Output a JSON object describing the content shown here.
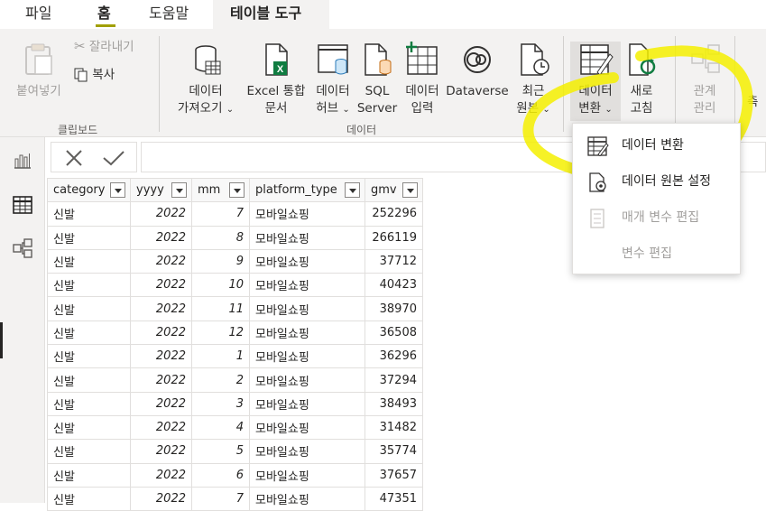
{
  "tabs": [
    {
      "label": "파일"
    },
    {
      "label": "홈"
    },
    {
      "label": "도움말"
    },
    {
      "label": "테이블 도구"
    }
  ],
  "ribbon": {
    "clipboard": {
      "paste": "붙여넣기",
      "cut": "잘라내기",
      "copy": "복사",
      "group": "클립보드"
    },
    "data": {
      "get_data": [
        "데이터",
        "가져오기"
      ],
      "excel": [
        "Excel 통합",
        "문서"
      ],
      "hub": [
        "데이터",
        "허브"
      ],
      "sql": [
        "SQL",
        "Server"
      ],
      "enter": [
        "데이터",
        "입력"
      ],
      "dataverse": "Dataverse",
      "recent": [
        "최근",
        "원본"
      ],
      "group": "데이터"
    },
    "transform": [
      "데이터",
      "변환"
    ],
    "refresh": [
      "새로",
      "고침"
    ],
    "relations": [
      "관계",
      "관리"
    ],
    "calc_partial": "측"
  },
  "menu": {
    "items": [
      {
        "label": "데이터 변환",
        "enabled": true,
        "icon": "transform-data-icon"
      },
      {
        "label": "데이터 원본 설정",
        "enabled": true,
        "icon": "data-source-settings-icon"
      },
      {
        "label": "매개 변수 편집",
        "enabled": false,
        "icon": "edit-parameters-icon"
      },
      {
        "label": "변수 편집",
        "enabled": false,
        "icon": ""
      }
    ]
  },
  "table": {
    "columns": [
      "category",
      "yyyy",
      "mm",
      "platform_type",
      "gmv"
    ],
    "rows": [
      [
        "신발",
        "2022",
        "7",
        "모바일쇼핑",
        "252296"
      ],
      [
        "신발",
        "2022",
        "8",
        "모바일쇼핑",
        "266119"
      ],
      [
        "신발",
        "2022",
        "9",
        "모바일쇼핑",
        "37712"
      ],
      [
        "신발",
        "2022",
        "10",
        "모바일쇼핑",
        "40423"
      ],
      [
        "신발",
        "2022",
        "11",
        "모바일쇼핑",
        "38970"
      ],
      [
        "신발",
        "2022",
        "12",
        "모바일쇼핑",
        "36508"
      ],
      [
        "신발",
        "2022",
        "1",
        "모바일쇼핑",
        "36296"
      ],
      [
        "신발",
        "2022",
        "2",
        "모바일쇼핑",
        "37294"
      ],
      [
        "신발",
        "2022",
        "3",
        "모바일쇼핑",
        "38493"
      ],
      [
        "신발",
        "2022",
        "4",
        "모바일쇼핑",
        "31482"
      ],
      [
        "신발",
        "2022",
        "5",
        "모바일쇼핑",
        "35774"
      ],
      [
        "신발",
        "2022",
        "6",
        "모바일쇼핑",
        "37657"
      ],
      [
        "신발",
        "2022",
        "7",
        "모바일쇼핑",
        "47351"
      ]
    ]
  },
  "colors": {
    "accent": "#a19f00",
    "highlighter": "#f4f000",
    "excel_green": "#107c41"
  }
}
